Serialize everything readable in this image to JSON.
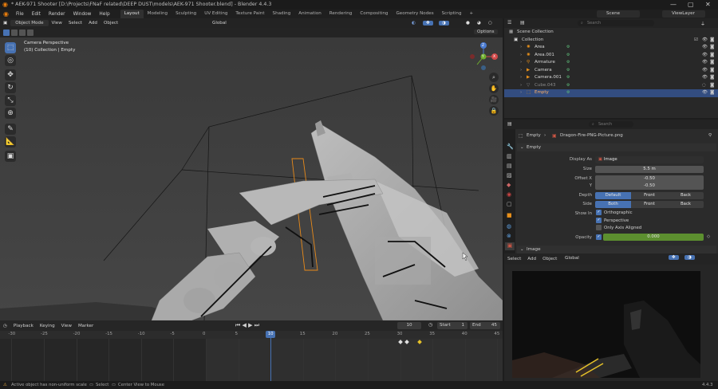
{
  "window": {
    "title": "* AEK-971 Shooter [D:\\Projects\\FNaF related\\DEEP DUST\\models\\AEK-971 Shooter.blend] - Blender 4.4.3",
    "controls": [
      "—",
      "▢",
      "✕"
    ]
  },
  "menu": {
    "items": [
      "File",
      "Edit",
      "Render",
      "Window",
      "Help"
    ],
    "workspaces": [
      "Layout",
      "Modeling",
      "Sculpting",
      "UV Editing",
      "Texture Paint",
      "Shading",
      "Animation",
      "Rendering",
      "Compositing",
      "Geometry Nodes",
      "Scripting"
    ],
    "active_workspace": "Layout",
    "add_tab": "+",
    "scene": "Scene",
    "view_layer": "ViewLayer"
  },
  "viewport": {
    "mode": "Object Mode",
    "menus": [
      "View",
      "Select",
      "Add",
      "Object"
    ],
    "orientation": "Global",
    "options": "Options",
    "overlay_line1": "Camera Perspective",
    "overlay_line2": "(10) Collection | Empty",
    "gizmo": {
      "x": "X",
      "y": "Y",
      "z": "Z"
    }
  },
  "outliner": {
    "search_placeholder": "Search",
    "root": "Scene Collection",
    "collection": "Collection",
    "items": [
      {
        "name": "Area",
        "selected": false,
        "dim": false
      },
      {
        "name": "Area.001",
        "selected": false,
        "dim": false
      },
      {
        "name": "Armature",
        "selected": false,
        "dim": false
      },
      {
        "name": "Camera",
        "selected": false,
        "dim": false
      },
      {
        "name": "Camera.001",
        "selected": false,
        "dim": false
      },
      {
        "name": "Cube.043",
        "selected": false,
        "dim": true
      },
      {
        "name": "Empty",
        "selected": true,
        "dim": false
      }
    ]
  },
  "properties": {
    "search_placeholder": "Search",
    "breadcrumb_object": "Empty",
    "breadcrumb_image": "Dragon-Fire-PNG-Picture.png",
    "panel_empty": "Empty",
    "display_as_label": "Display As",
    "display_as_value": "Image",
    "size_label": "Size",
    "size_value": "5.5 m",
    "offset_x_label": "Offset X",
    "offset_x_value": "-0.50",
    "offset_y_label": "Y",
    "offset_y_value": "-0.50",
    "depth_label": "Depth",
    "depth_options": [
      "Default",
      "Front",
      "Back"
    ],
    "depth_selected": "Default",
    "side_label": "Side",
    "side_options": [
      "Both",
      "Front",
      "Back"
    ],
    "side_selected": "Both",
    "show_in_label": "Show In",
    "show_orthographic": "Orthographic",
    "show_perspective": "Perspective",
    "only_axis_aligned": "Only Axis Aligned",
    "opacity_label": "Opacity",
    "opacity_value": "0.000",
    "panel_image": "Image"
  },
  "image_view": {
    "menus": [
      "Select",
      "Add",
      "Object"
    ],
    "orientation": "Global"
  },
  "timeline": {
    "menus": [
      "Playback",
      "Keying",
      "View",
      "Marker"
    ],
    "current_frame": "10",
    "start_label": "Start",
    "start_value": "1",
    "end_label": "End",
    "end_value": "45",
    "ticks": [
      -30,
      -25,
      -20,
      -15,
      -10,
      -5,
      0,
      5,
      10,
      15,
      20,
      25,
      30,
      35,
      40,
      45
    ],
    "playhead_frame": 10,
    "keyframes": [
      30,
      31,
      33
    ]
  },
  "statusbar": {
    "warning": "Active object has non-uniform scale",
    "select": "Select",
    "center": "Center View to Mouse",
    "version": "4.4.3"
  },
  "colors": {
    "accent": "#4772b3",
    "selection": "#334d80",
    "opacity_bar": "#5c8f2f",
    "keyframe": "#e6c229"
  }
}
